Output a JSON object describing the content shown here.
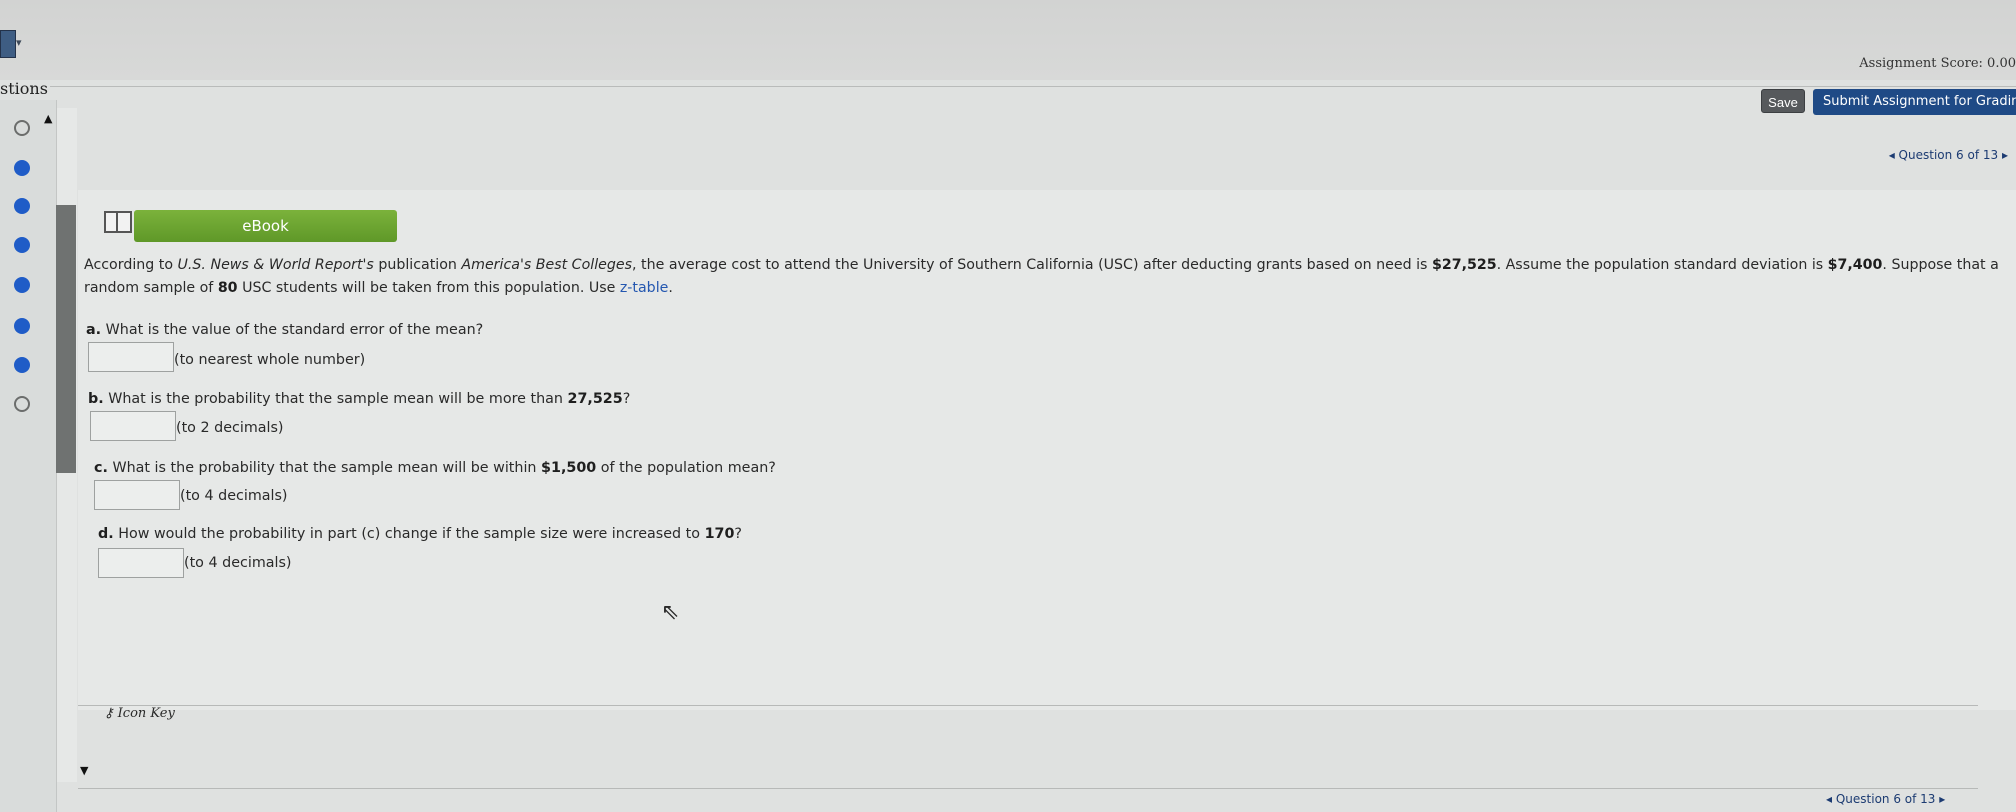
{
  "header": {
    "assignment_score": "Assignment Score: 0.00",
    "save_label": "Save",
    "submit_label": "Submit Assignment for Grading",
    "question_nav": "Question 6 of 13"
  },
  "sidebar": {
    "tab_label": "stions",
    "statuses": [
      "open",
      "answered",
      "answered",
      "answered",
      "answered",
      "answered",
      "answered",
      "open"
    ]
  },
  "ebook": {
    "label": "eBook"
  },
  "question": {
    "intro_prefix": "According to ",
    "source_title": "U.S. News & World Report's",
    "intro_mid": " publication ",
    "pub_title": "America's Best Colleges",
    "intro_rest": ", the average cost to attend the University of Southern California (USC) after deducting grants based on need is ",
    "avg_cost": "$27,525",
    "intro_after_cost": ". Assume the population standard deviation is ",
    "std_dev": "$7,400",
    "intro_after_sd": ". Suppose that a random sample of ",
    "sample_size": "80",
    "intro_after_n": " USC students will be taken from this population. Use ",
    "ztable_link": "z-table",
    "intro_end": "."
  },
  "parts": {
    "a": {
      "label": "a.",
      "text": "What is the value of the standard error of the mean?",
      "hint": "(to nearest whole number)"
    },
    "b": {
      "label": "b.",
      "text": "What is the probability that the sample mean will be more than ",
      "value": "27,525",
      "end": "?",
      "hint": "(to 2 decimals)"
    },
    "c": {
      "label": "c.",
      "text": "What is the probability that the sample mean will be within ",
      "value": "$1,500",
      "end": " of the population mean?",
      "hint": "(to 4 decimals)"
    },
    "d": {
      "label": "d.",
      "text": "How would the probability in part (c) change if the sample size were increased to ",
      "value": "170",
      "end": "?",
      "hint": "(to 4 decimals)"
    }
  },
  "footer": {
    "icon_key": "Icon Key",
    "question_nav": "Question 6 of 13"
  },
  "colors": {
    "ebook_green": "#6aa531",
    "submit_blue": "#1f4a86",
    "answered_blue": "#1f5cc7",
    "link_blue": "#2457b0"
  },
  "icons": [
    "menu-icon",
    "book-icon",
    "key-icon",
    "pointer-icon",
    "chevron-left-icon",
    "chevron-right-icon",
    "scroll-up-icon",
    "scroll-down-icon"
  ]
}
